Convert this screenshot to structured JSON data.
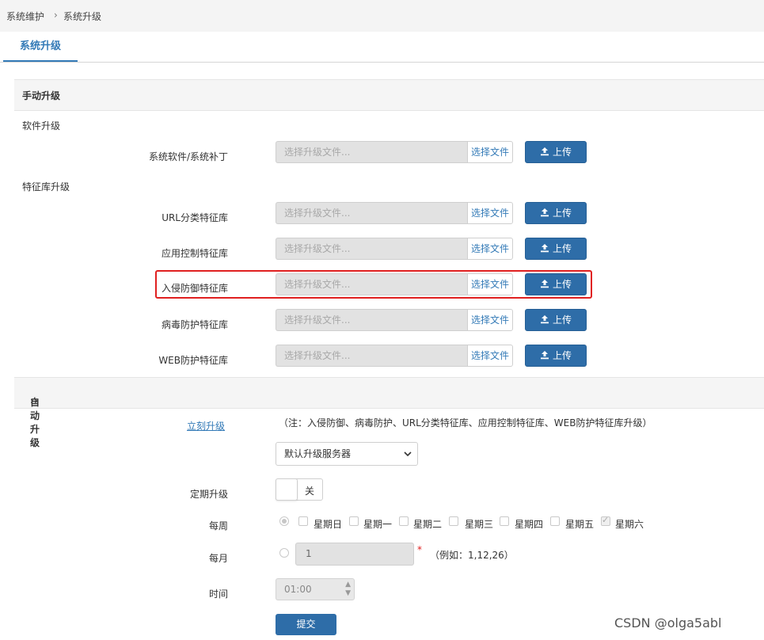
{
  "breadcrumb": {
    "parent": "系统维护",
    "separator": "›",
    "current": "系统升级"
  },
  "tab": {
    "label": "系统升级"
  },
  "manual": {
    "section_title": "手动升级",
    "software_title": "软件升级",
    "signature_title": "特征库升级",
    "file_placeholder": "选择升级文件...",
    "choose_label": "选择文件",
    "upload_label": "上传",
    "rows": [
      {
        "label": "系统软件/系统补丁"
      },
      {
        "label": "URL分类特征库"
      },
      {
        "label": "应用控制特征库"
      },
      {
        "label": "入侵防御特征库"
      },
      {
        "label": "病毒防护特征库"
      },
      {
        "label": "WEB防护特征库"
      }
    ]
  },
  "auto": {
    "section_title": "自动升级",
    "section_icon": "double-chevron-right-icon",
    "now_link": "立刻升级",
    "note": "（注：入侵防御、病毒防护、URL分类特征库、应用控制特征库、WEB防护特征库升级）",
    "server_select": "默认升级服务器",
    "schedule_label": "定期升级",
    "toggle_text": "关",
    "weekly_label": "每周",
    "days": [
      {
        "label": "星期日",
        "checked": false
      },
      {
        "label": "星期一",
        "checked": false
      },
      {
        "label": "星期二",
        "checked": false
      },
      {
        "label": "星期三",
        "checked": false
      },
      {
        "label": "星期四",
        "checked": false
      },
      {
        "label": "星期五",
        "checked": false
      },
      {
        "label": "星期六",
        "checked": true
      }
    ],
    "monthly_label": "每月",
    "monthly_value": "1",
    "required_mark": "*",
    "monthly_example": "（例如：1,12,26）",
    "time_label": "时间",
    "time_value": "01:00",
    "submit_label": "提交"
  },
  "watermark": "CSDN @olga5abl",
  "colors": {
    "accent": "#337ab7",
    "button": "#2e6da8",
    "highlight": "#e02020"
  }
}
